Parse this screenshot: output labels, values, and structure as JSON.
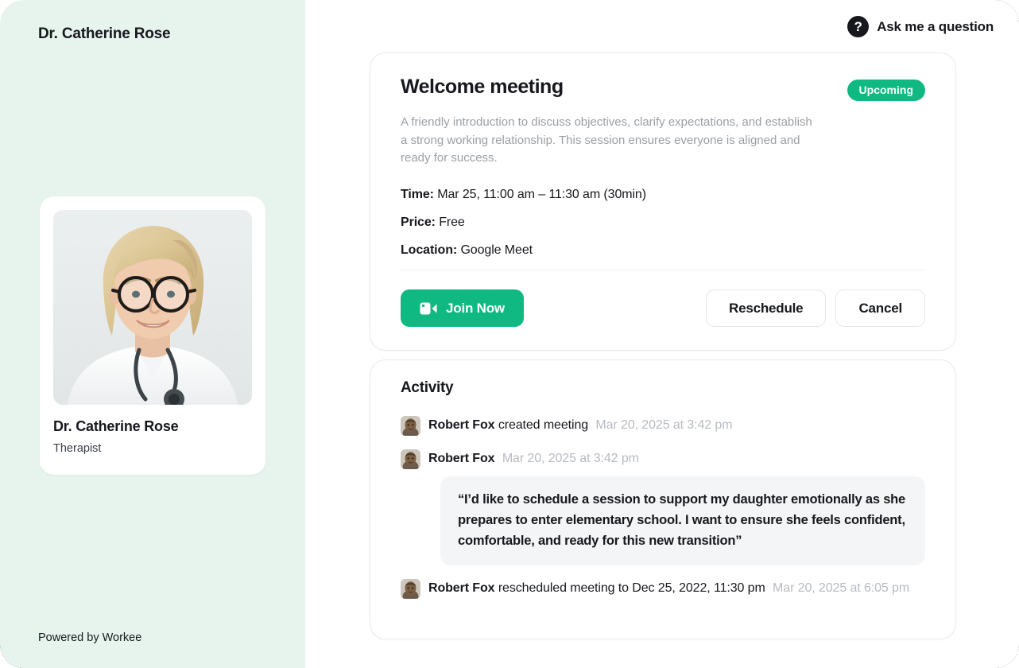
{
  "window": {
    "background": "#ffffff",
    "sidebar_background": "#e7f4ee",
    "accent": "#10b981",
    "text_primary": "#16181d",
    "text_muted": "#9aa0a6"
  },
  "sidebar": {
    "title": "Dr. Catherine Rose",
    "profile": {
      "name": "Dr. Catherine Rose",
      "role": "Therapist",
      "photo_icon": "therapist-portrait-photo"
    },
    "footer": "Powered by Workee"
  },
  "topbar": {
    "help_icon": "question-mark-circle-icon",
    "help_glyph": "?",
    "label": "Ask me a question"
  },
  "meeting": {
    "title": "Welcome meeting",
    "badge": "Upcoming",
    "badge_color": "#10b981",
    "description": "A friendly introduction to discuss objectives, clarify expectations, and establish a strong working relationship. This session ensures everyone is aligned and ready for success.",
    "details": [
      {
        "label": "Time:",
        "value": "Mar 25, 11:00 am – 11:30 am (30min)"
      },
      {
        "label": "Price:",
        "value": "Free"
      },
      {
        "label": "Location:",
        "value": "Google Meet"
      }
    ],
    "actions": {
      "join": "Join Now",
      "join_icon": "video-camera-icon",
      "reschedule": "Reschedule",
      "cancel": "Cancel"
    }
  },
  "activity": {
    "title": "Activity",
    "entries": [
      {
        "avatar_icon": "user-avatar-photo",
        "user": "Robert Fox",
        "action": "created meeting",
        "time": "Mar 20, 2025 at 3:42 pm"
      },
      {
        "avatar_icon": "user-avatar-photo",
        "user": "Robert Fox",
        "action": "",
        "time": "Mar 20, 2025 at 3:42 pm"
      },
      {
        "avatar_icon": "user-avatar-photo",
        "user": "Robert Fox",
        "action": "rescheduled meeting to Dec 25, 2022, 11:30 pm",
        "time": "Mar 20, 2025 at 6:05 pm"
      }
    ],
    "quote": "“I’d like to schedule a session to support my daughter emotionally as she prepares to enter elementary school. I want to ensure she feels confident, comfortable, and ready for this new transition”"
  }
}
